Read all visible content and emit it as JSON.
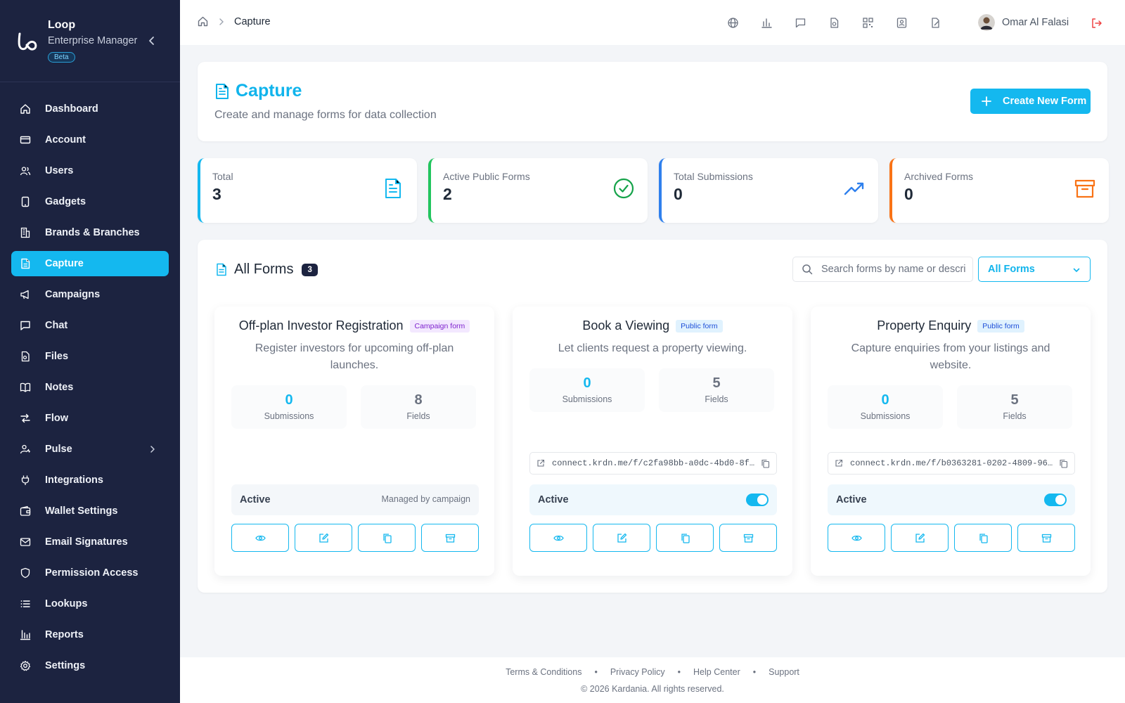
{
  "brand": {
    "name": "Loop",
    "subtitle": "Enterprise Manager",
    "badge": "Beta"
  },
  "sidebar": {
    "items": [
      {
        "label": "Dashboard",
        "icon": "home-icon"
      },
      {
        "label": "Account",
        "icon": "credit-card-icon"
      },
      {
        "label": "Users",
        "icon": "users-icon"
      },
      {
        "label": "Gadgets",
        "icon": "tablet-icon"
      },
      {
        "label": "Brands & Branches",
        "icon": "building-icon"
      },
      {
        "label": "Capture",
        "icon": "document-icon",
        "active": true
      },
      {
        "label": "Campaigns",
        "icon": "megaphone-icon"
      },
      {
        "label": "Chat",
        "icon": "chat-icon"
      },
      {
        "label": "Files",
        "icon": "files-icon"
      },
      {
        "label": "Notes",
        "icon": "book-icon"
      },
      {
        "label": "Flow",
        "icon": "flow-icon"
      },
      {
        "label": "Pulse",
        "icon": "pulse-user-icon",
        "has_submenu": true
      },
      {
        "label": "Integrations",
        "icon": "plug-icon"
      },
      {
        "label": "Wallet Settings",
        "icon": "wallet-icon"
      },
      {
        "label": "Email Signatures",
        "icon": "mail-icon"
      },
      {
        "label": "Permission Access",
        "icon": "shield-icon"
      },
      {
        "label": "Lookups",
        "icon": "list-icon"
      },
      {
        "label": "Reports",
        "icon": "bar-chart-icon"
      },
      {
        "label": "Settings",
        "icon": "gear-icon"
      }
    ]
  },
  "header": {
    "breadcrumb_current": "Capture",
    "user_name": "Omar Al Falasi"
  },
  "hero": {
    "title": "Capture",
    "subtitle": "Create and manage forms for data collection",
    "create_label": "Create New Form"
  },
  "stats": [
    {
      "label": "Total",
      "value": "3",
      "color": "#14b8ef"
    },
    {
      "label": "Active Public Forms",
      "value": "2",
      "color": "#22c55e"
    },
    {
      "label": "Total Submissions",
      "value": "0",
      "color": "#2f80ed"
    },
    {
      "label": "Archived Forms",
      "value": "0",
      "color": "#f97316"
    }
  ],
  "forms_panel": {
    "title": "All Forms",
    "count": "3",
    "search_placeholder": "Search forms by name or description",
    "filter_label": "All Forms"
  },
  "forms": [
    {
      "title": "Off-plan Investor Registration",
      "tag": "Campaign form",
      "description": "Register investors for upcoming off-plan launches.",
      "submissions": "0",
      "submissions_label": "Submissions",
      "fields": "8",
      "fields_label": "Fields",
      "status": "Active",
      "managed_text": "Managed by campaign"
    },
    {
      "title": "Book a Viewing",
      "tag": "Public form",
      "description": "Let clients request a property viewing.",
      "submissions": "0",
      "submissions_label": "Submissions",
      "fields": "5",
      "fields_label": "Fields",
      "url": "connect.krdn.me/f/c2fa98bb-a0dc-4bd0-8f…",
      "status": "Active",
      "toggle_on": true
    },
    {
      "title": "Property Enquiry",
      "tag": "Public form",
      "description": "Capture enquiries from your listings and website.",
      "submissions": "0",
      "submissions_label": "Submissions",
      "fields": "5",
      "fields_label": "Fields",
      "url": "connect.krdn.me/f/b0363281-0202-4809-96…",
      "status": "Active",
      "toggle_on": true
    }
  ],
  "footer": {
    "links": [
      "Terms & Conditions",
      "Privacy Policy",
      "Help Center",
      "Support"
    ],
    "copyright": "© 2026 Kardania. All rights reserved."
  },
  "colors": {
    "sidebar_bg": "#1c2340",
    "accent": "#14b8ef",
    "campaign_tag": "#7e22ce",
    "public_tag": "#1d4ed8"
  }
}
